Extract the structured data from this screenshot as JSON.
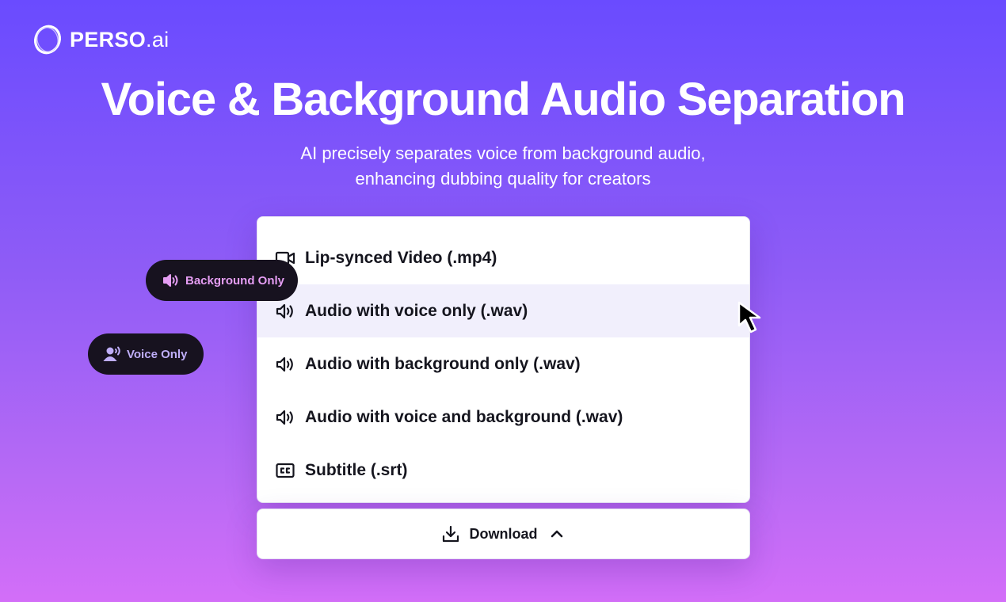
{
  "brand": {
    "name": "PERSO",
    "suffix": ".ai"
  },
  "hero": {
    "title": "Voice & Background Audio Separation",
    "subtitle_line1": "AI precisely separates voice from background audio,",
    "subtitle_line2": "enhancing dubbing quality for creators"
  },
  "download_menu": {
    "items": [
      {
        "label": "Lip-synced Video (.mp4)",
        "icon": "video-camera-icon"
      },
      {
        "label": "Audio with voice only (.wav)",
        "icon": "speaker-icon",
        "highlighted": true
      },
      {
        "label": "Audio with background only (.wav)",
        "icon": "speaker-icon"
      },
      {
        "label": "Audio with voice and background (.wav)",
        "icon": "speaker-icon"
      },
      {
        "label": "Subtitle (.srt)",
        "icon": "closed-captions-icon"
      }
    ],
    "button_label": "Download",
    "button_icons": [
      "download-icon",
      "chevron-up-icon"
    ]
  },
  "tags": {
    "background_only": "Background Only",
    "voice_only": "Voice Only"
  },
  "colors": {
    "gradient_top": "#6a4bff",
    "gradient_bottom": "#d36ef8",
    "pill_background": "#17121f",
    "background_tag_text": "#e59df3",
    "voice_tag_text": "#bfaef8",
    "menu_highlight": "#f1effc"
  }
}
